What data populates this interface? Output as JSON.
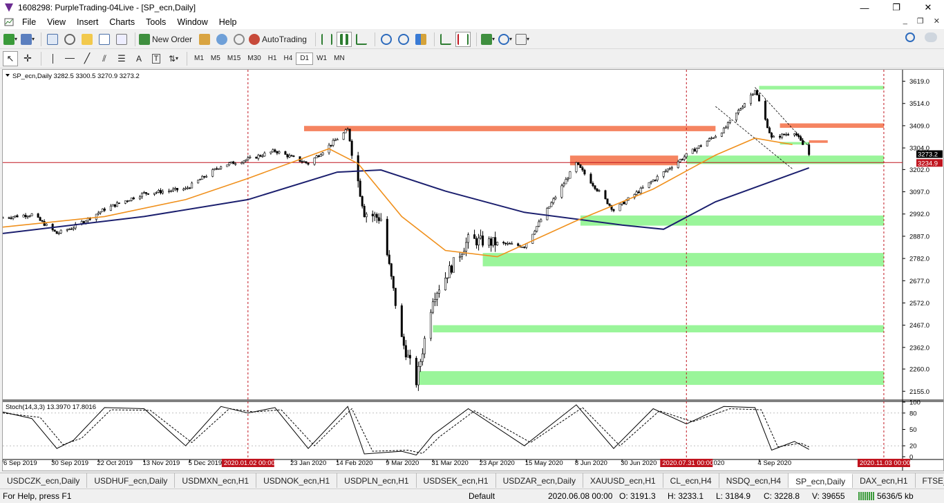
{
  "window": {
    "title": "1608298: PurpleTrading-04Live - [SP_ecn,Daily]",
    "min_glyph": "—",
    "max_glyph": "❐",
    "close_glyph": "✕"
  },
  "menu": {
    "items": [
      "File",
      "View",
      "Insert",
      "Charts",
      "Tools",
      "Window",
      "Help"
    ],
    "mdi_min": "_",
    "mdi_restore": "❐",
    "mdi_close": "✕"
  },
  "toolbar": {
    "new_order_label": "New Order",
    "autotrading_label": "AutoTrading",
    "timeframes": [
      "M1",
      "M5",
      "M15",
      "M30",
      "H1",
      "H4",
      "D1",
      "W1",
      "MN"
    ],
    "active_timeframe": "D1"
  },
  "chart_data": {
    "type": "candlestick",
    "symbol_header": "SP_ecn,Daily  3282.5 3300.5 3270.9 3273.2",
    "last_price_label": "3273.2",
    "bid_line_label": "3234.9",
    "ylim": [
      2120,
      3660
    ],
    "y_ticks": [
      3619.0,
      3514.0,
      3409.0,
      3304.0,
      3202.0,
      3097.0,
      2992.0,
      2887.0,
      2782.0,
      2677.0,
      2572.0,
      2467.0,
      2362.0,
      2260.0,
      2155.0
    ],
    "x_tick_labels": [
      "6 Sep 2019",
      "30 Sep 2019",
      "22 Oct 2019",
      "13 Nov 2019",
      "5 Dec 2019",
      "23 Jan 2020",
      "14 Feb 2020",
      "9 Mar 2020",
      "31 Mar 2020",
      "23 Apr 2020",
      "15 May 2020",
      "8 Jun 2020",
      "30 Jun 2020",
      "3 Aug 2020",
      "4 Sep 2020"
    ],
    "vertical_markers": [
      "2020.01.02 00:00",
      "2020.07.31 00:00",
      "2020.11.03 00:00"
    ],
    "bid_line_value": 3234.9,
    "price_path": [
      [
        "2019-09-06",
        2975
      ],
      [
        "2019-09-20",
        2990
      ],
      [
        "2019-10-02",
        2900
      ],
      [
        "2019-10-10",
        2930
      ],
      [
        "2019-10-25",
        3015
      ],
      [
        "2019-11-13",
        3090
      ],
      [
        "2019-12-03",
        3110
      ],
      [
        "2019-12-20",
        3220
      ],
      [
        "2020-01-02",
        3250
      ],
      [
        "2020-01-15",
        3290
      ],
      [
        "2020-01-31",
        3230
      ],
      [
        "2020-02-19",
        3390
      ],
      [
        "2020-02-27",
        3000
      ],
      [
        "2020-03-06",
        2970
      ],
      [
        "2020-03-16",
        2400
      ],
      [
        "2020-03-23",
        2200
      ],
      [
        "2020-03-31",
        2600
      ],
      [
        "2020-04-17",
        2870
      ],
      [
        "2020-05-14",
        2840
      ],
      [
        "2020-06-08",
        3230
      ],
      [
        "2020-06-26",
        3010
      ],
      [
        "2020-07-31",
        3270
      ],
      [
        "2020-08-18",
        3390
      ],
      [
        "2020-09-02",
        3580
      ],
      [
        "2020-09-10",
        3350
      ],
      [
        "2020-09-21",
        3380
      ],
      [
        "2020-09-28",
        3273
      ]
    ],
    "ma_fast": [
      [
        "2019-09-06",
        2930
      ],
      [
        "2019-10-25",
        2980
      ],
      [
        "2019-12-03",
        3060
      ],
      [
        "2020-01-02",
        3160
      ],
      [
        "2020-02-10",
        3300
      ],
      [
        "2020-02-24",
        3230
      ],
      [
        "2020-03-16",
        2980
      ],
      [
        "2020-04-06",
        2820
      ],
      [
        "2020-05-01",
        2790
      ],
      [
        "2020-06-08",
        2960
      ],
      [
        "2020-07-15",
        3110
      ],
      [
        "2020-08-14",
        3270
      ],
      [
        "2020-09-02",
        3350
      ],
      [
        "2020-09-20",
        3320
      ]
    ],
    "ma_slow": [
      [
        "2019-09-06",
        2900
      ],
      [
        "2019-11-13",
        2980
      ],
      [
        "2020-01-02",
        3060
      ],
      [
        "2020-02-14",
        3190
      ],
      [
        "2020-03-06",
        3200
      ],
      [
        "2020-04-06",
        3100
      ],
      [
        "2020-05-14",
        3000
      ],
      [
        "2020-06-30",
        2940
      ],
      [
        "2020-07-20",
        2920
      ],
      [
        "2020-08-14",
        3050
      ],
      [
        "2020-09-28",
        3210
      ]
    ],
    "zones_resistance": [
      {
        "from": "2020-01-29",
        "price": [
          3383,
          3408
        ],
        "to": "2020-08-14"
      },
      {
        "from": "2020-06-05",
        "price": [
          3222,
          3268
        ],
        "to": "2020-07-27"
      },
      {
        "from": "2020-09-14",
        "price": [
          3399,
          3420
        ],
        "to": "2020-11-03"
      },
      {
        "from": "2020-09-28",
        "price": [
          3328,
          3340
        ],
        "to": "2020-10-07"
      }
    ],
    "zones_support": [
      {
        "from": "2020-09-04",
        "price": [
          3580,
          3597
        ],
        "to": "2020-11-03"
      },
      {
        "from": "2020-07-31",
        "price": [
          3228,
          3268
        ],
        "to": "2020-11-03"
      },
      {
        "from": "2020-09-14",
        "price": [
          3320,
          3332
        ],
        "to": "2020-09-28"
      },
      {
        "from": "2020-06-10",
        "price": [
          2937,
          2985
        ],
        "to": "2020-11-03"
      },
      {
        "from": "2020-04-24",
        "price": [
          2745,
          2808
        ],
        "to": "2020-11-03"
      },
      {
        "from": "2020-03-31",
        "price": [
          2433,
          2467
        ],
        "to": "2020-11-03"
      },
      {
        "from": "2020-03-23",
        "price": [
          2185,
          2250
        ],
        "to": "2020-11-03"
      }
    ],
    "indicator": {
      "label": "Stoch(14,3,3) 13.3970 17.8016",
      "ylim": [
        0,
        100
      ],
      "y_ticks": [
        100,
        80,
        50,
        20,
        0
      ],
      "levels": [
        80,
        20
      ],
      "main": [
        [
          "2019-09-06",
          82
        ],
        [
          "2019-09-20",
          70
        ],
        [
          "2019-10-02",
          15
        ],
        [
          "2019-10-10",
          30
        ],
        [
          "2019-10-25",
          90
        ],
        [
          "2019-11-13",
          88
        ],
        [
          "2019-12-03",
          20
        ],
        [
          "2019-12-20",
          92
        ],
        [
          "2020-01-02",
          80
        ],
        [
          "2020-01-15",
          90
        ],
        [
          "2020-01-31",
          15
        ],
        [
          "2020-02-19",
          92
        ],
        [
          "2020-02-27",
          5
        ],
        [
          "2020-03-16",
          10
        ],
        [
          "2020-03-23",
          3
        ],
        [
          "2020-03-31",
          40
        ],
        [
          "2020-04-17",
          88
        ],
        [
          "2020-05-14",
          20
        ],
        [
          "2020-06-08",
          95
        ],
        [
          "2020-06-26",
          15
        ],
        [
          "2020-07-15",
          88
        ],
        [
          "2020-07-31",
          60
        ],
        [
          "2020-08-18",
          92
        ],
        [
          "2020-09-02",
          90
        ],
        [
          "2020-09-10",
          12
        ],
        [
          "2020-09-21",
          28
        ],
        [
          "2020-09-28",
          13.4
        ]
      ],
      "signal": [
        [
          "2019-09-06",
          80
        ],
        [
          "2019-09-24",
          72
        ],
        [
          "2019-10-05",
          22
        ],
        [
          "2019-10-14",
          34
        ],
        [
          "2019-10-28",
          86
        ],
        [
          "2019-11-16",
          85
        ],
        [
          "2019-12-06",
          26
        ],
        [
          "2019-12-24",
          88
        ],
        [
          "2020-01-05",
          82
        ],
        [
          "2020-01-18",
          86
        ],
        [
          "2020-02-03",
          20
        ],
        [
          "2020-02-21",
          88
        ],
        [
          "2020-03-02",
          10
        ],
        [
          "2020-03-19",
          12
        ],
        [
          "2020-03-26",
          6
        ],
        [
          "2020-04-03",
          36
        ],
        [
          "2020-04-20",
          84
        ],
        [
          "2020-05-17",
          26
        ],
        [
          "2020-06-11",
          90
        ],
        [
          "2020-06-29",
          20
        ],
        [
          "2020-07-18",
          84
        ],
        [
          "2020-08-03",
          64
        ],
        [
          "2020-08-21",
          88
        ],
        [
          "2020-09-05",
          86
        ],
        [
          "2020-09-13",
          18
        ],
        [
          "2020-09-24",
          25
        ],
        [
          "2020-09-28",
          17.8
        ]
      ]
    },
    "colors": {
      "candle": "#000000",
      "ma_fast": "#f0901c",
      "ma_slow": "#1b1f6e",
      "resistance": "#f58461",
      "support": "#9af59a",
      "marker": "#c0141e",
      "bid_line": "#c0141e"
    }
  },
  "tabs": {
    "items": [
      "USDCZK_ecn,Daily",
      "USDHUF_ecn,Daily",
      "USDMXN_ecn,H1",
      "USDNOK_ecn,H1",
      "USDPLN_ecn,H1",
      "USDSEK_ecn,H1",
      "USDZAR_ecn,Daily",
      "XAUUSD_ecn,H1",
      "CL_ecn,H4",
      "NSDQ_ecn,H4",
      "SP_ecn,Daily",
      "DAX_ecn,H1",
      "FTSE_ecn,D"
    ],
    "active": "SP_ecn,Daily"
  },
  "status": {
    "help": "For Help, press F1",
    "profile": "Default",
    "datetime": "2020.06.08 00:00",
    "open": "O: 3191.3",
    "high": "H: 3233.1",
    "low": "L: 3184.9",
    "close": "C: 3228.8",
    "volume": "V: 39655",
    "traffic": "5636/5 kb"
  }
}
